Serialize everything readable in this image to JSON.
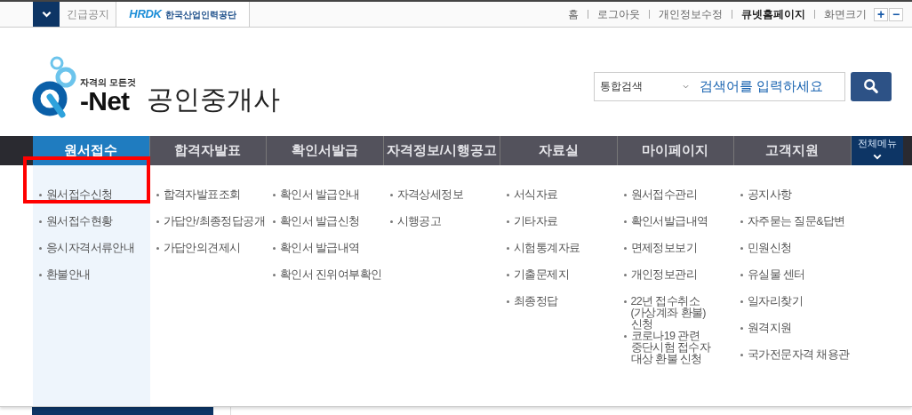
{
  "top_bar": {
    "notice": "긴급공지",
    "agency_logo": {
      "mark": "HRDK",
      "name": "한국산업인력공단"
    },
    "links": [
      {
        "label": "홈",
        "bold": false
      },
      {
        "label": "로그아웃",
        "bold": false
      },
      {
        "label": "개인정보수정",
        "bold": false
      },
      {
        "label": "큐넷홈페이지",
        "bold": true
      },
      {
        "label": "화면크기",
        "bold": false
      }
    ],
    "zoom_buttons": [
      "+",
      "−"
    ]
  },
  "header": {
    "logo": {
      "tagline": "자격의 모든것",
      "name": "-Net"
    },
    "title": "공인중개사",
    "search": {
      "scope": "통합검색",
      "placeholder": "검색어를 입력하세요"
    }
  },
  "nav": {
    "tabs": [
      {
        "label": "원서접수",
        "selected": true
      },
      {
        "label": "합격자발표",
        "selected": false
      },
      {
        "label": "확인서발급",
        "selected": false
      },
      {
        "label": "자격정보/시행공고",
        "selected": false
      },
      {
        "label": "자료실",
        "selected": false
      },
      {
        "label": "마이페이지",
        "selected": false
      },
      {
        "label": "고객지원",
        "selected": false
      }
    ],
    "all_menu": "전체메뉴"
  },
  "dropdown": {
    "columns": [
      {
        "items": [
          {
            "label": "원서접수신청",
            "highlighted": true
          },
          {
            "label": "원서접수현황",
            "highlighted": false
          },
          {
            "label": "응시자격서류안내",
            "highlighted": false
          },
          {
            "label": "환불안내",
            "highlighted": false
          }
        ]
      },
      {
        "items": [
          {
            "label": "합격자발표조회",
            "highlighted": false
          },
          {
            "label": "가답안/최종정답공개",
            "highlighted": false
          },
          {
            "label": "가답안의견제시",
            "highlighted": false
          }
        ]
      },
      {
        "items": [
          {
            "label": "확인서 발급안내",
            "highlighted": false
          },
          {
            "label": "확인서 발급신청",
            "highlighted": false
          },
          {
            "label": "확인서 발급내역",
            "highlighted": false
          },
          {
            "label": "확인서 진위여부확인",
            "highlighted": false
          }
        ]
      },
      {
        "items": [
          {
            "label": "자격상세정보",
            "highlighted": false
          },
          {
            "label": "시행공고",
            "highlighted": false
          }
        ]
      },
      {
        "items": [
          {
            "label": "서식자료",
            "highlighted": false
          },
          {
            "label": "기타자료",
            "highlighted": false
          },
          {
            "label": "시험통계자료",
            "highlighted": false
          },
          {
            "label": "기출문제지",
            "highlighted": false
          },
          {
            "label": "최종정답",
            "highlighted": false
          }
        ]
      },
      {
        "items": [
          {
            "label": "원서접수관리",
            "highlighted": false
          },
          {
            "label": "확인서발급내역",
            "highlighted": false
          },
          {
            "label": "면제정보보기",
            "highlighted": false
          },
          {
            "label": "개인정보관리",
            "highlighted": false
          },
          {
            "label": "22년 접수취소\n(가상계좌 환불)\n신청",
            "highlighted": false
          },
          {
            "label": "코로나19 관련\n중단시험 접수자\n대상 환불 신청",
            "highlighted": false
          }
        ]
      },
      {
        "items": [
          {
            "label": "공지사항",
            "highlighted": false
          },
          {
            "label": "자주묻는 질문&답변",
            "highlighted": false
          },
          {
            "label": "민원신청",
            "highlighted": false
          },
          {
            "label": "유실물 센터",
            "highlighted": false
          },
          {
            "label": "일자리찾기",
            "highlighted": false
          },
          {
            "label": "원격지원",
            "highlighted": false
          },
          {
            "label": "국가전문자격 채용관",
            "highlighted": false
          }
        ]
      }
    ]
  }
}
